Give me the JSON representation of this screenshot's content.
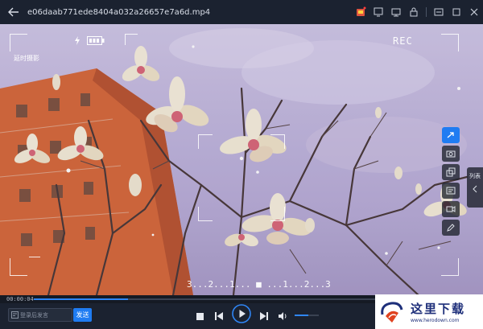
{
  "titlebar": {
    "filename": "e06daab771ede8404a032a26657e7a6d.mp4",
    "icons": [
      "back-arrow-icon",
      "store-icon",
      "mini-player-icon",
      "screen-icon",
      "lock-icon",
      "minimize-icon",
      "restore-icon",
      "close-icon"
    ]
  },
  "overlay": {
    "rec": "REC",
    "top_left_label": "延时摄影",
    "countdown": "3...2...1... ■ ...1...2...3"
  },
  "sidebar": {
    "items": [
      "share-icon",
      "screenshot-icon",
      "copy-icon",
      "subtitle-icon",
      "record-icon",
      "edit-icon"
    ],
    "list_label": "列表"
  },
  "progress": {
    "current_time": "00:00:04",
    "played_fraction": 0.21
  },
  "controls": {
    "danmu_placeholder": "登录后发言",
    "send_label": "发送",
    "volume_fraction": 0.55
  },
  "logo": {
    "name": "这里下载",
    "url": "www.herodown.com"
  },
  "colors": {
    "accent": "#1f7cf2",
    "bar": "#1b2230"
  }
}
